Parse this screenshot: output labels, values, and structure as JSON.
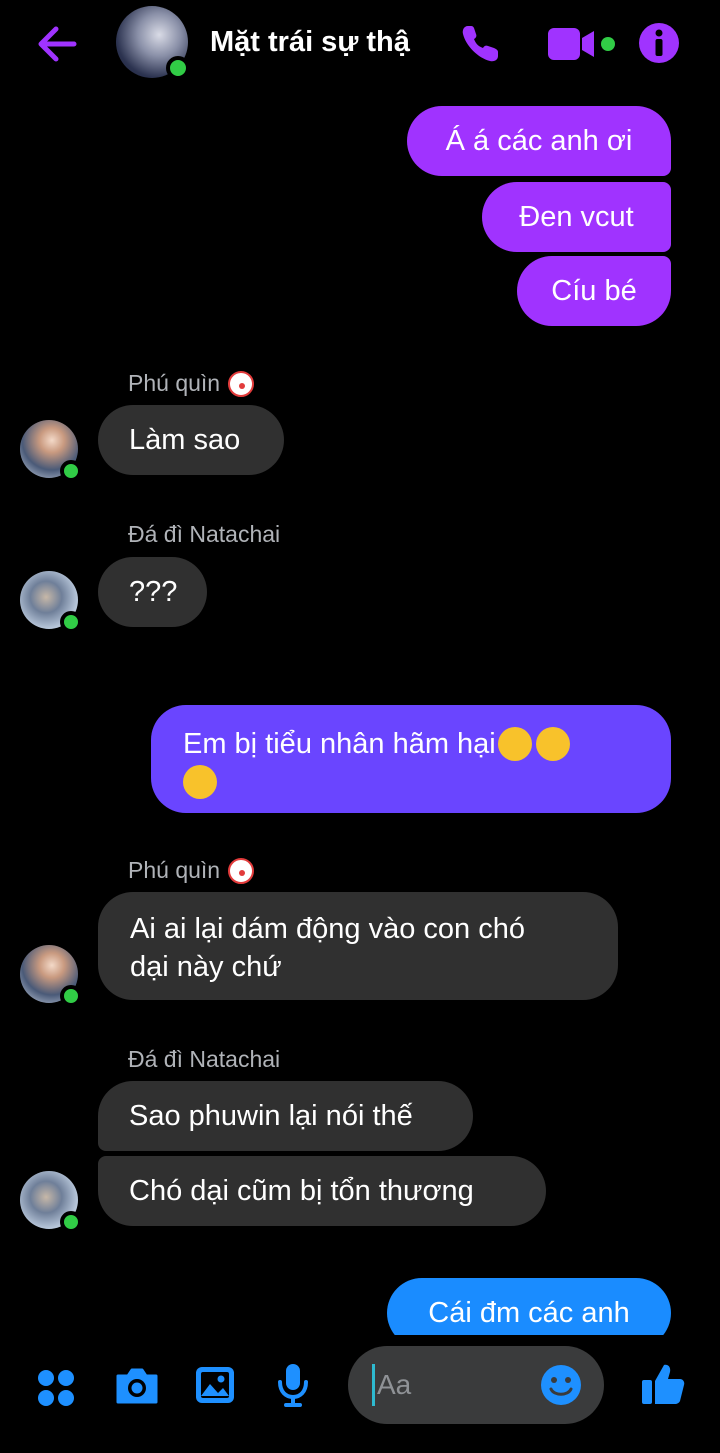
{
  "header": {
    "title": "Mặt trái sự thậ",
    "accent_color": "#a033ff",
    "icons": [
      "back-arrow-icon",
      "phone-icon",
      "video-camera-icon",
      "info-icon"
    ]
  },
  "messages": [
    {
      "side": "out",
      "text": "Á á các anh ơi"
    },
    {
      "side": "out",
      "text": "Đen vcut"
    },
    {
      "side": "out",
      "text": "Cíu bé"
    },
    {
      "side": "in",
      "sender": "Phú quìn",
      "text": "Làm sao"
    },
    {
      "side": "in",
      "sender": "Đá đì Natachai",
      "text": "???"
    },
    {
      "side": "out",
      "text_line1": "Em bị tiểu nhân hãm hại",
      "emoji": "crying-face-emoji"
    },
    {
      "side": "in",
      "sender": "Phú quìn",
      "text_line1": "Ai ai lại dám động vào con chó",
      "text_line2": "dại này chứ"
    },
    {
      "side": "in",
      "sender": "Đá đì Natachai",
      "text": "Sao phuwin lại nói thế"
    },
    {
      "side": "in",
      "text": "Chó dại cũm bị tổn thương"
    },
    {
      "side": "out",
      "text": "Cái đm các anh"
    }
  ],
  "composer": {
    "placeholder": "Aa",
    "icons": [
      "apps-grid-icon",
      "camera-icon",
      "gallery-icon",
      "microphone-icon",
      "emoji-icon",
      "thumbs-up-icon"
    ]
  },
  "colors": {
    "outgoing_purple": "#a033ff",
    "outgoing_blue_violet": "#6a45ff",
    "outgoing_blue": "#1a8cff",
    "incoming_bubble": "#303030",
    "composer_accent": "#1e90ff"
  }
}
